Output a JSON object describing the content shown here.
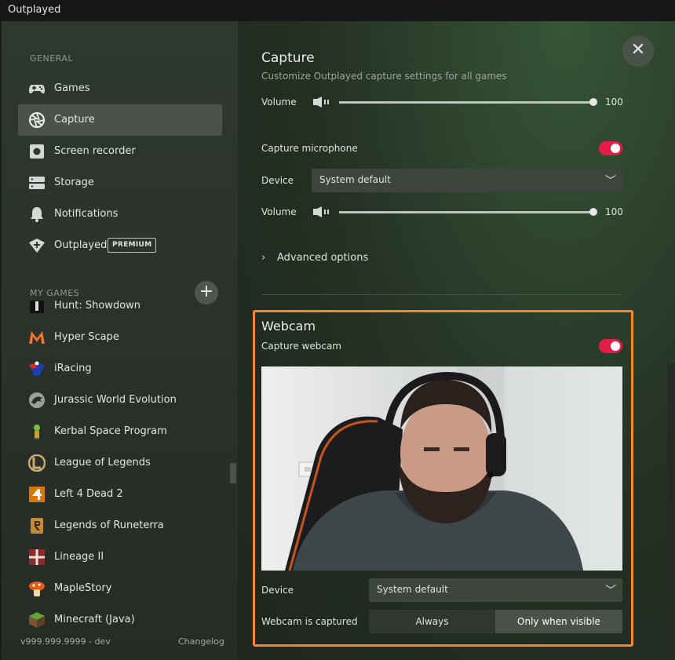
{
  "app": {
    "title": "Outplayed"
  },
  "sidebar": {
    "general_label": "GENERAL",
    "nav": [
      {
        "label": "Games",
        "icon": "gamepad-icon"
      },
      {
        "label": "Capture",
        "icon": "aperture-icon",
        "active": true
      },
      {
        "label": "Screen recorder",
        "icon": "record-icon"
      },
      {
        "label": "Storage",
        "icon": "storage-icon"
      },
      {
        "label": "Notifications",
        "icon": "bell-icon"
      },
      {
        "label": "Outplayed",
        "icon": "outplayed-icon",
        "badge": "PREMIUM"
      }
    ],
    "my_games_label": "MY GAMES",
    "add_symbol": "+",
    "games": [
      {
        "label": "Hunt: Showdown",
        "icon": "hunt-showdown-icon"
      },
      {
        "label": "Hyper Scape",
        "icon": "hyper-scape-icon"
      },
      {
        "label": "iRacing",
        "icon": "iracing-icon"
      },
      {
        "label": "Jurassic World Evolution",
        "icon": "jurassic-world-icon"
      },
      {
        "label": "Kerbal Space Program",
        "icon": "kerbal-icon"
      },
      {
        "label": "League of Legends",
        "icon": "league-of-legends-icon"
      },
      {
        "label": "Left 4 Dead 2",
        "icon": "left4dead-icon"
      },
      {
        "label": "Legends of Runeterra",
        "icon": "runeterra-icon"
      },
      {
        "label": "Lineage II",
        "icon": "lineage-icon"
      },
      {
        "label": "MapleStory",
        "icon": "maplestory-icon"
      },
      {
        "label": "Minecraft (Java)",
        "icon": "minecraft-icon"
      }
    ],
    "version": "v999.999.9999 - dev",
    "changelog": "Changelog"
  },
  "capture": {
    "title": "Capture",
    "subtitle": "Customize Outplayed capture settings for all games",
    "volume_label": "Volume",
    "volume_value": "100",
    "mic_label": "Capture microphone",
    "mic_enabled": true,
    "device_label": "Device",
    "device_value": "System default",
    "mic_volume_label": "Volume",
    "mic_volume_value": "100",
    "advanced_label": "Advanced options"
  },
  "webcam": {
    "title": "Webcam",
    "capture_label": "Capture webcam",
    "enabled": true,
    "device_label": "Device",
    "device_value": "System default",
    "captured_label": "Webcam is captured",
    "options": [
      "Always",
      "Only when visible"
    ],
    "selected": "Only when visible"
  },
  "colors": {
    "accent": "#e11d48",
    "highlight": "#f58a25"
  }
}
